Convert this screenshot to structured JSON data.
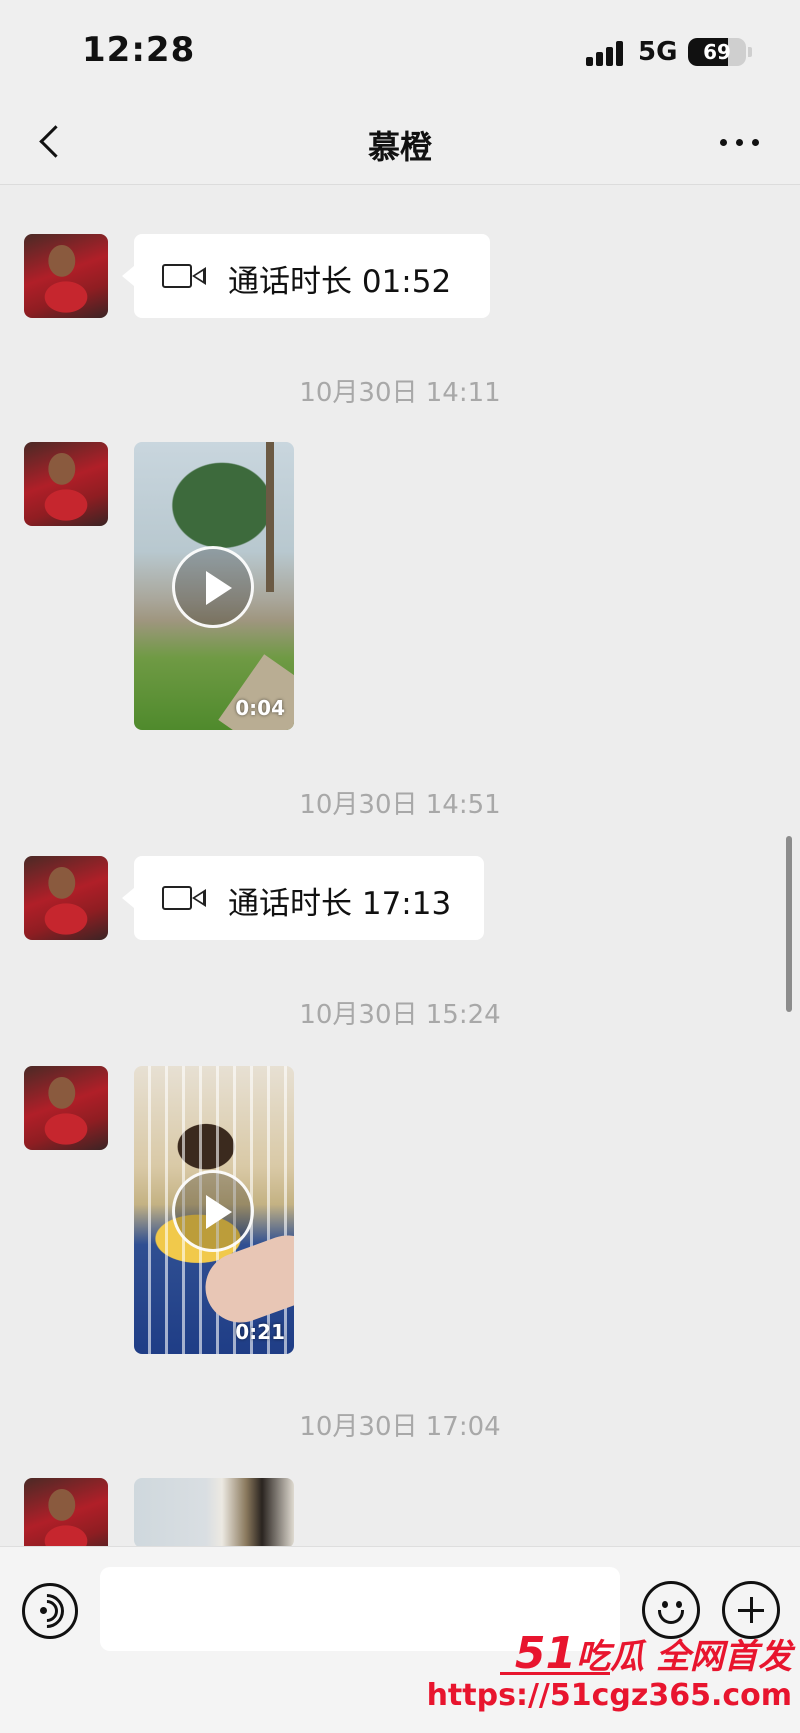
{
  "status_bar": {
    "time": "12:28",
    "network": "5G",
    "battery": "69",
    "battery_level": 0.69
  },
  "header": {
    "title": "慕橙"
  },
  "messages": {
    "call1": "通话时长 01:52",
    "ts1": "10月30日 14:11",
    "video1_duration": "0:04",
    "ts2": "10月30日 14:51",
    "call2": "通话时长 17:13",
    "ts3": "10月30日 15:24",
    "video2_duration": "0:21",
    "ts4": "10月30日 17:04"
  },
  "input": {
    "value": ""
  },
  "watermark": {
    "logo_num": "51",
    "logo_text": "吃瓜 全网首发",
    "url": "https://51cgz365.com"
  },
  "icons": [
    "back-icon",
    "more-icon",
    "video-call-icon",
    "play-icon",
    "voice-icon",
    "emoji-icon",
    "plus-icon"
  ]
}
